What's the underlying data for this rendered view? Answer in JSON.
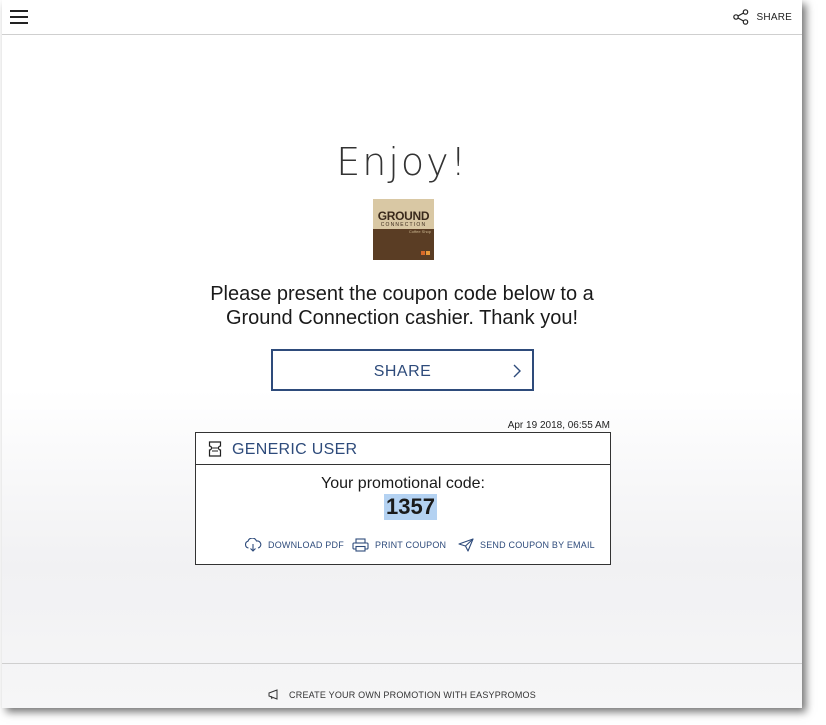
{
  "header": {
    "share_label": "SHARE"
  },
  "main": {
    "title": "Enjoy!",
    "logo": {
      "line1": "GROUND",
      "line2": "CONNECTION",
      "line3": "Coffee Shop"
    },
    "message_line1": "Please present the coupon code below to a",
    "message_line2": "Ground Connection cashier. Thank you!",
    "share_button_label": "SHARE",
    "timestamp": "Apr 19 2018, 06:55 AM"
  },
  "coupon": {
    "user_name": "GENERIC USER",
    "promo_label": "Your promotional code:",
    "promo_code": "1357",
    "actions": {
      "download": "DOWNLOAD PDF",
      "print": "PRINT COUPON",
      "email": "SEND COUPON BY EMAIL"
    }
  },
  "footer": {
    "label": "CREATE YOUR OWN PROMOTION WITH EASYPROMOS"
  },
  "colors": {
    "accent": "#2e4b7b",
    "code_highlight": "#b4d2f2"
  }
}
